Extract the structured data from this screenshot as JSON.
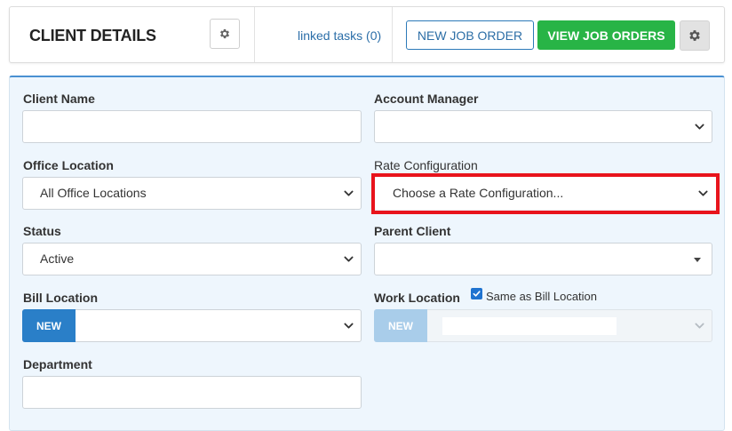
{
  "header": {
    "title": "CLIENT DETAILS",
    "linked_tasks": "linked tasks (0)",
    "new_job_order": "NEW JOB ORDER",
    "view_job_orders": "VIEW JOB ORDERS"
  },
  "form": {
    "client_name": {
      "label": "Client Name",
      "value": ""
    },
    "account_manager": {
      "label": "Account Manager",
      "value": ""
    },
    "office_location": {
      "label": "Office Location",
      "value": "All Office Locations"
    },
    "rate_configuration": {
      "label": "Rate Configuration",
      "value": "Choose a Rate Configuration..."
    },
    "status": {
      "label": "Status",
      "value": "Active"
    },
    "parent_client": {
      "label": "Parent Client",
      "value": ""
    },
    "bill_location": {
      "label": "Bill Location",
      "new_label": "NEW",
      "value": ""
    },
    "work_location": {
      "label": "Work Location",
      "new_label": "NEW",
      "same_as_bill_label": "Same as Bill Location",
      "same_as_bill_checked": true
    },
    "department": {
      "label": "Department",
      "value": ""
    }
  },
  "colors": {
    "accent_blue": "#2c7ab8",
    "green": "#28b446",
    "highlight_red": "#e8141c",
    "new_button": "#2a7fc8",
    "new_button_disabled": "#a9cdea"
  },
  "icons": {
    "settings": "gear-icon",
    "dropdown": "chevron-down-icon"
  }
}
